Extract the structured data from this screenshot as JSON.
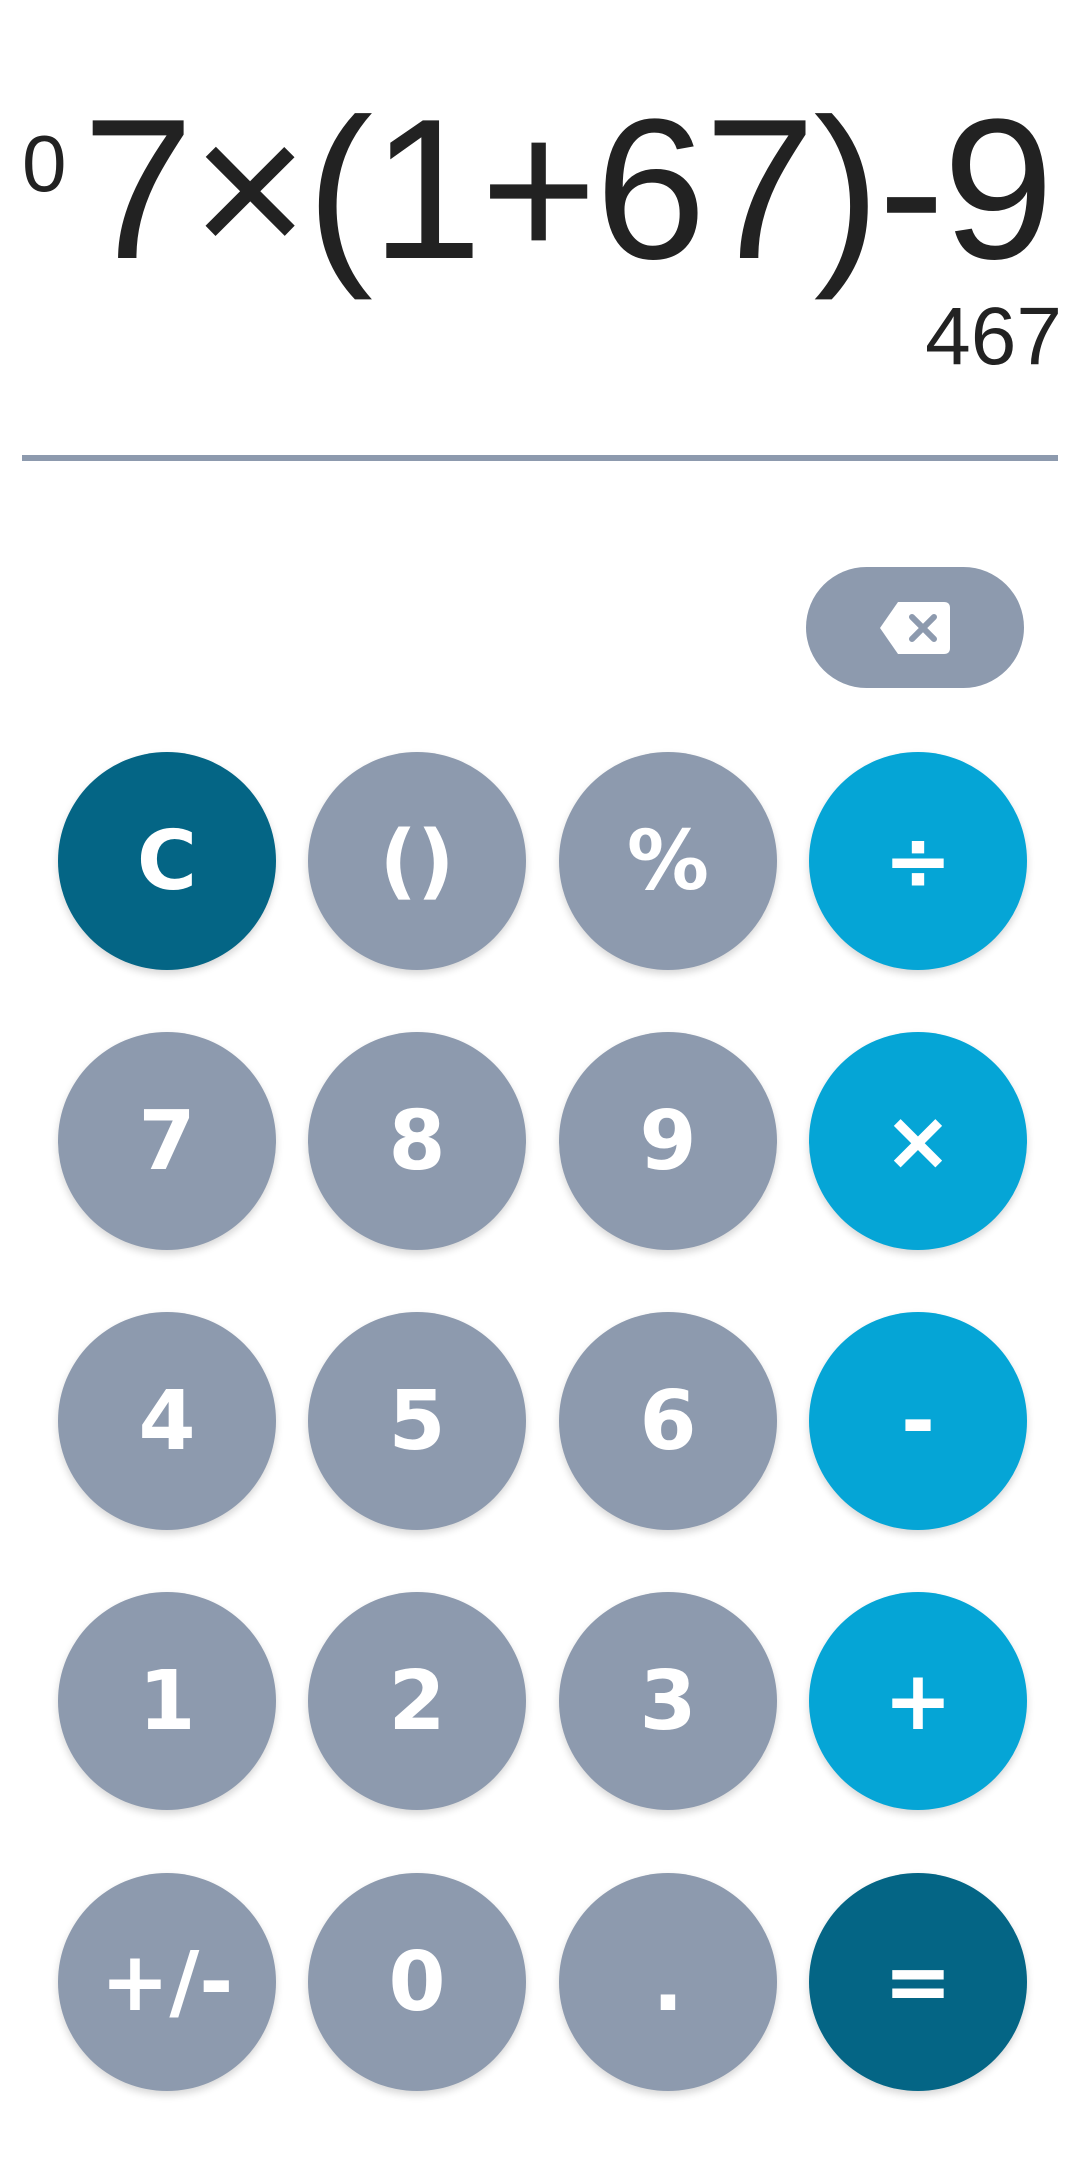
{
  "display": {
    "memory": "0",
    "expression": "7×(1+67)-9",
    "result": "467"
  },
  "keypad": {
    "backspace_icon": "backspace-icon",
    "rows": [
      [
        {
          "label": "C",
          "style": "dark",
          "name": "clear-button"
        },
        {
          "label": "()",
          "style": "gray",
          "name": "parentheses-button"
        },
        {
          "label": "%",
          "style": "gray",
          "name": "percent-button"
        },
        {
          "label": "÷",
          "style": "op",
          "name": "divide-button"
        }
      ],
      [
        {
          "label": "7",
          "style": "gray",
          "name": "digit-7-button"
        },
        {
          "label": "8",
          "style": "gray",
          "name": "digit-8-button"
        },
        {
          "label": "9",
          "style": "gray",
          "name": "digit-9-button"
        },
        {
          "label": "×",
          "style": "op",
          "name": "multiply-button"
        }
      ],
      [
        {
          "label": "4",
          "style": "gray",
          "name": "digit-4-button"
        },
        {
          "label": "5",
          "style": "gray",
          "name": "digit-5-button"
        },
        {
          "label": "6",
          "style": "gray",
          "name": "digit-6-button"
        },
        {
          "label": "-",
          "style": "op",
          "name": "subtract-button"
        }
      ],
      [
        {
          "label": "1",
          "style": "gray",
          "name": "digit-1-button"
        },
        {
          "label": "2",
          "style": "gray",
          "name": "digit-2-button"
        },
        {
          "label": "3",
          "style": "gray",
          "name": "digit-3-button"
        },
        {
          "label": "+",
          "style": "op",
          "name": "add-button"
        }
      ],
      [
        {
          "label": "+/-",
          "style": "gray",
          "name": "sign-toggle-button"
        },
        {
          "label": "0",
          "style": "gray",
          "name": "digit-0-button"
        },
        {
          "label": ".",
          "style": "gray",
          "name": "decimal-button"
        },
        {
          "label": "=",
          "style": "dark",
          "name": "equals-button"
        }
      ]
    ]
  },
  "colors": {
    "gray_key": "#8d9aae",
    "operator_key": "#05a5d6",
    "accent_key": "#046585",
    "text": "#222222"
  }
}
